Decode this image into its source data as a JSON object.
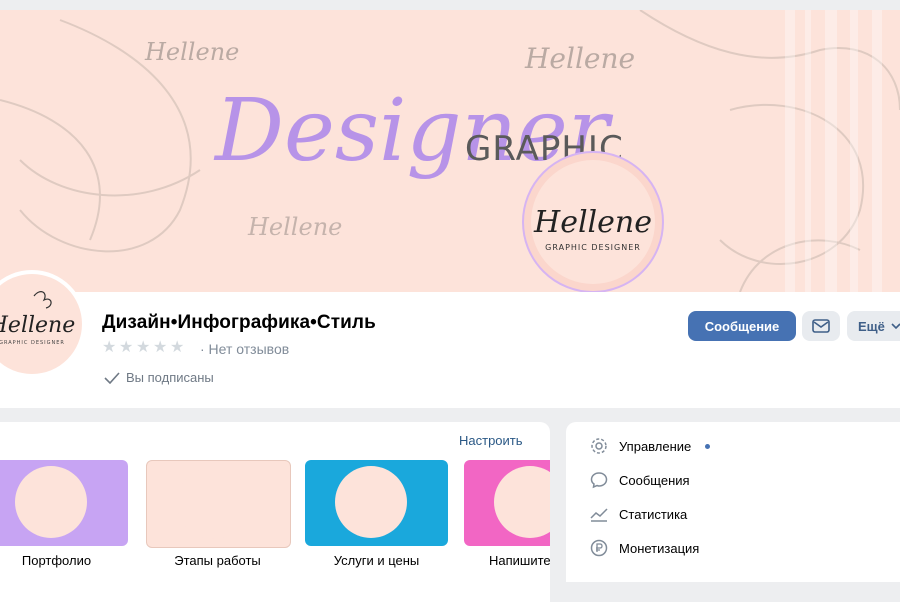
{
  "cover": {
    "script_word": "Designer",
    "graphic_word": "GRAPHIC",
    "logo_name": "Hellene",
    "logo_subtitle": "GRAPHIC DESIGNER"
  },
  "group": {
    "title": "Дизайн•Инфографика•Стиль",
    "rating_text": "· Нет отзывов",
    "rating_stars": 0,
    "subscribed_label": "Вы подписаны"
  },
  "actions": {
    "message_label": "Сообщение",
    "more_label": "Ещё"
  },
  "links": {
    "configure_label": "Настроить",
    "items": [
      {
        "label": "Портфолио",
        "bg": "#c7a4f3"
      },
      {
        "label": "Этапы работы",
        "bg": "#fde3da"
      },
      {
        "label": "Услуги и цены",
        "bg": "#1aa8dc"
      },
      {
        "label": "Напишите",
        "bg": "#f266c4"
      }
    ]
  },
  "menu": {
    "items": [
      {
        "label": "Управление",
        "icon": "gear-icon"
      },
      {
        "label": "Сообщения",
        "icon": "chat-icon"
      },
      {
        "label": "Статистика",
        "icon": "stats-icon"
      },
      {
        "label": "Монетизация",
        "icon": "ruble-icon"
      }
    ]
  },
  "colors": {
    "accent": "#4672b3",
    "cover_bg": "#fde3da",
    "script_color": "#b793e8"
  }
}
